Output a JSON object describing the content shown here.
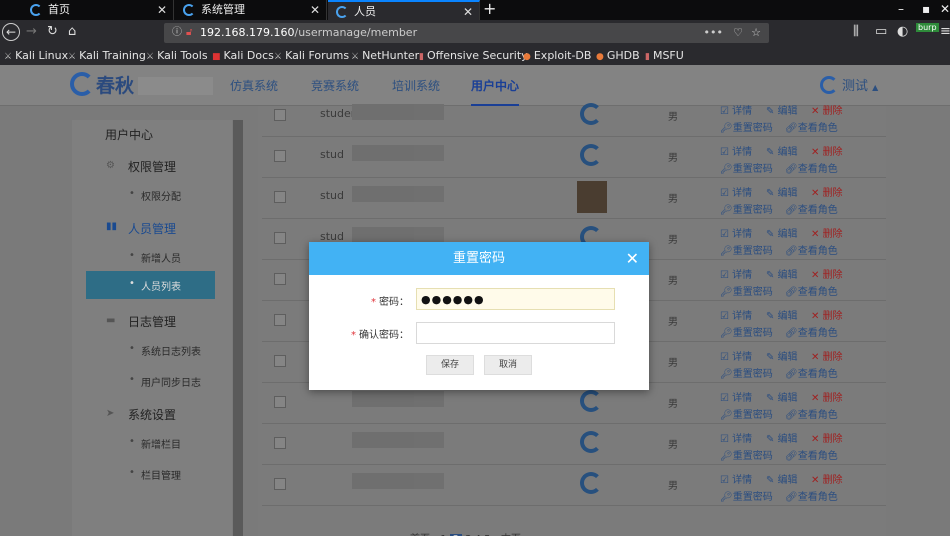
{
  "browser": {
    "tabs": [
      {
        "label": "首页",
        "close": "✕"
      },
      {
        "label": "系统管理",
        "close": "✕"
      },
      {
        "label": "人员",
        "close": "✕"
      }
    ],
    "new_tab": "+",
    "url_host": "192.168.179.160",
    "url_path": "/usermanage/member",
    "url_menu": "•••",
    "bookmarks": [
      "Kali Linux",
      "Kali Training",
      "Kali Tools",
      "Kali Docs",
      "Kali Forums",
      "NetHunter",
      "Offensive Security",
      "Exploit-DB",
      "GHDB",
      "MSFU"
    ],
    "burp_badge": "burp"
  },
  "app": {
    "logo_text": "春秋",
    "nav": [
      "仿真系统",
      "竞赛系统",
      "培训系统",
      "用户中心"
    ],
    "user_name": "测试",
    "user_caret": "▲"
  },
  "sidebar": {
    "title": "用户中心",
    "sections": [
      {
        "label": "权限管理",
        "items": [
          "权限分配"
        ]
      },
      {
        "label": "人员管理",
        "items": [
          "新增人员",
          "人员列表"
        ]
      },
      {
        "label": "日志管理",
        "items": [
          "系统日志列表",
          "用户同步日志"
        ]
      },
      {
        "label": "系统设置",
        "items": [
          "新增栏目",
          "栏目管理"
        ]
      }
    ]
  },
  "table": {
    "rows": [
      {
        "name": "studen",
        "sex": "男"
      },
      {
        "name": "stud",
        "sex": "男"
      },
      {
        "name": "stud",
        "sex": "男"
      },
      {
        "name": "stud",
        "sex": "男"
      },
      {
        "name": "",
        "sex": "男"
      },
      {
        "name": "",
        "sex": "男"
      },
      {
        "name": "",
        "sex": "男"
      },
      {
        "name": "",
        "sex": "男"
      },
      {
        "name": "",
        "sex": "男"
      },
      {
        "name": "",
        "sex": "男"
      }
    ],
    "actions": {
      "detail": "详情",
      "edit": "编辑",
      "delete": "删除",
      "reset": "重置密码",
      "roles": "查看角色"
    }
  },
  "modal": {
    "title": "重置密码",
    "close": "✕",
    "password_label": "密码：",
    "password_value": "●●●●●●",
    "confirm_label": "确认密码：",
    "confirm_value": "",
    "required_mark": "*",
    "save_label": "保存",
    "cancel_label": "取消"
  }
}
